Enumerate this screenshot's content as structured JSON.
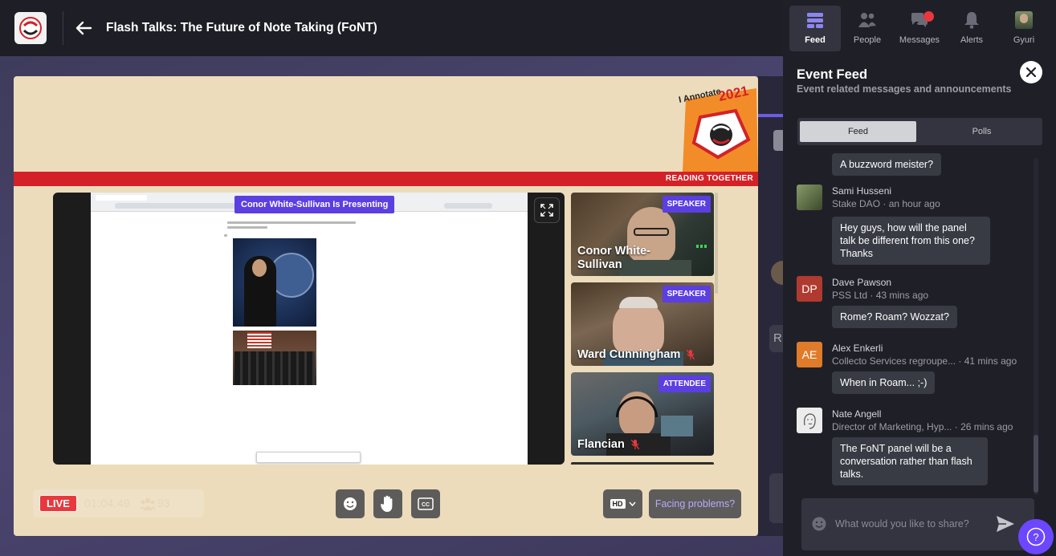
{
  "header": {
    "title": "Flash Talks: The Future of Note Taking (FoNT)"
  },
  "stage": {
    "banner_text": "READING TOGETHER",
    "badge_text": "I Annotate",
    "badge_year": "2021",
    "presenting_label": "Conor White-Sullivan Is Presenting"
  },
  "participants": [
    {
      "name": "Conor White-\nSullivan",
      "role": "SPEAKER",
      "muted": false
    },
    {
      "name": "Ward Cunningham",
      "role": "SPEAKER",
      "muted": true
    },
    {
      "name": "Flancian",
      "role": "ATTENDEE",
      "muted": true
    }
  ],
  "controls": {
    "live_label": "LIVE",
    "timer": "01:04:49",
    "attendees": "93",
    "quality": "HD",
    "problems_label": "Facing problems?"
  },
  "nav": {
    "items": [
      {
        "label": "Feed",
        "icon": "feed-icon",
        "active": true
      },
      {
        "label": "People",
        "icon": "people-icon",
        "active": false
      },
      {
        "label": "Messages",
        "icon": "messages-icon",
        "active": false
      },
      {
        "label": "Alerts",
        "icon": "bell-icon",
        "active": false
      },
      {
        "label": "Gyuri",
        "icon": "user-avatar",
        "active": false
      }
    ]
  },
  "feed": {
    "title": "Event Feed",
    "subtitle": "Event related messages and announcements",
    "tabs": [
      "Feed",
      "Polls"
    ],
    "messages": [
      {
        "name": "",
        "org": "",
        "time": "",
        "text": "A buzzword meister?",
        "initials": "",
        "avatar_color": ""
      },
      {
        "name": "Sami Husseni",
        "org": "Stake DAO",
        "time": "an hour ago",
        "text": "Hey guys, how will the panel talk be different from this one? Thanks",
        "initials": "",
        "avatar_color": "#5b6b4a"
      },
      {
        "name": "Dave Pawson",
        "org": "PSS Ltd",
        "time": "43 mins ago",
        "text": "Rome? Roam? Wozzat?",
        "initials": "DP",
        "avatar_color": "#b03a30"
      },
      {
        "name": "Alex Enkerli",
        "org": "Collecto Services regroupe...",
        "time": "41 mins ago",
        "text": "When in Roam... ;-)",
        "initials": "AE",
        "avatar_color": "#e07b2a"
      },
      {
        "name": "Nate Angell",
        "org": "Director of Marketing, Hyp...",
        "time": "26 mins ago",
        "text": "The FoNT panel will be a conversation rather than flash talks.",
        "initials": "",
        "avatar_color": "#e8e8e8"
      }
    ],
    "compose_placeholder": "What would you like to share?"
  },
  "colors": {
    "accent": "#5b3fe0",
    "live": "#e8383d",
    "stage_bg": "#ecdcbc",
    "brand_red": "#d42128"
  }
}
